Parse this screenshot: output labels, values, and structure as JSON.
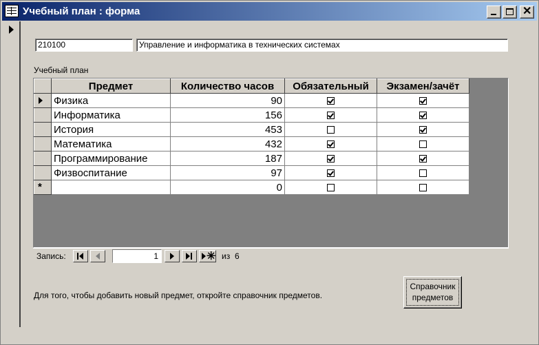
{
  "window": {
    "title": "Учебный план : форма"
  },
  "header": {
    "code": "210100",
    "name": "Управление и информатика в технических системах"
  },
  "subform": {
    "label": "Учебный план",
    "columns": [
      "Предмет",
      "Количество часов",
      "Обязательный",
      "Экзамен/зачёт"
    ],
    "rows": [
      {
        "subject": "Физика",
        "hours": "90",
        "required": true,
        "exam": true,
        "current": true
      },
      {
        "subject": "Информатика",
        "hours": "156",
        "required": true,
        "exam": true
      },
      {
        "subject": "История",
        "hours": "453",
        "required": false,
        "exam": true
      },
      {
        "subject": "Математика",
        "hours": "432",
        "required": true,
        "exam": false
      },
      {
        "subject": "Программирование",
        "hours": "187",
        "required": true,
        "exam": true
      },
      {
        "subject": "Физвоспитание",
        "hours": "97",
        "required": true,
        "exam": false
      }
    ],
    "new_row": {
      "symbol": "*",
      "hours": "0",
      "required": false,
      "exam": false
    }
  },
  "navigation": {
    "label": "Запись:",
    "current": "1",
    "of_label": "из",
    "total": "6"
  },
  "hint_text": "Для того, чтобы добавить новый предмет, откройте справочник предметов.",
  "reference_button": {
    "line1": "Справочник",
    "line2": "предметов"
  },
  "colors": {
    "title_start": "#0a246a",
    "title_end": "#a6caf0",
    "face": "#d4d0c8",
    "subform_bg": "#808080"
  }
}
